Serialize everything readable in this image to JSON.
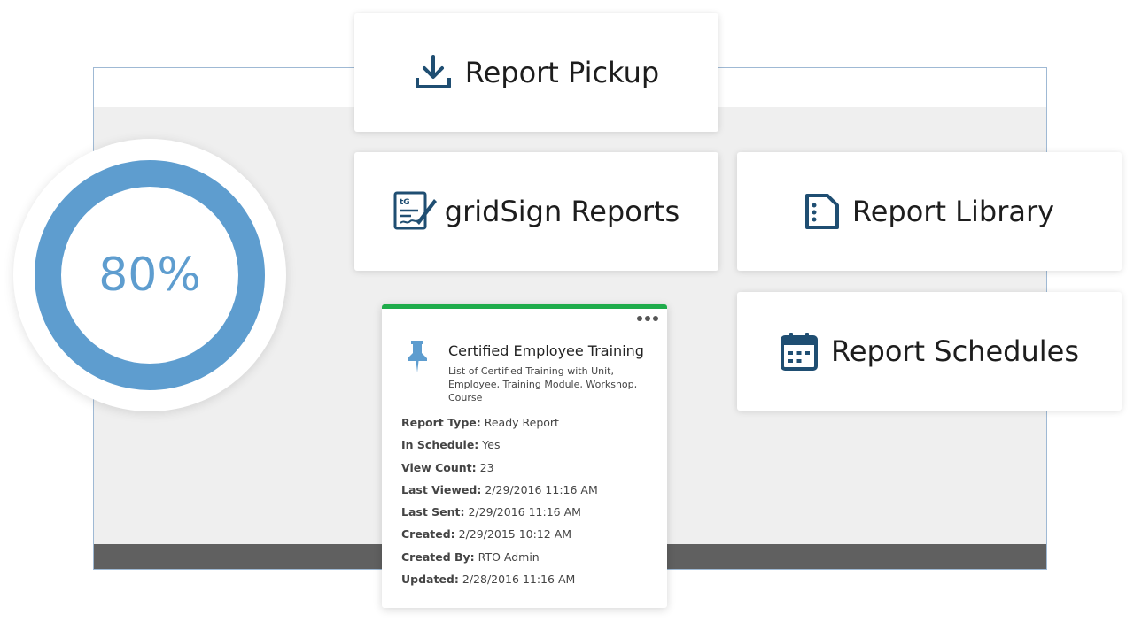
{
  "progress": {
    "label": "80%",
    "percent": 80,
    "colors": {
      "track": "#5e9dcf",
      "fill": "#1f4e72"
    }
  },
  "cards": {
    "report_pickup": {
      "label": "Report Pickup",
      "icon": "download-icon"
    },
    "gridsign_reports": {
      "label": "gridSign Reports",
      "icon": "gridsign-icon",
      "icon_text": "tG"
    },
    "report_library": {
      "label": "Report Library",
      "icon": "document-list-icon"
    },
    "report_schedules": {
      "label": "Report Schedules",
      "icon": "calendar-icon"
    }
  },
  "report": {
    "title": "Certified Employee Training",
    "description": "List of Certified Training with Unit, Employee, Training Module, Workshop, Course",
    "menu_icon": "more-options-icon",
    "pin_icon": "pin-icon",
    "accent_color": "#1fac4b",
    "details": [
      {
        "key": "Report Type:",
        "value": "Ready Report"
      },
      {
        "key": "In Schedule:",
        "value": "Yes"
      },
      {
        "key": "View Count:",
        "value": "23"
      },
      {
        "key": "Last Viewed:",
        "value": "2/29/2016 11:16 AM"
      },
      {
        "key": "Last Sent:",
        "value": "2/29/2016 11:16 AM"
      },
      {
        "key": "Created:",
        "value": "2/29/2015 10:12 AM"
      },
      {
        "key": "Created By:",
        "value": "RTO Admin"
      },
      {
        "key": "Updated:",
        "value": "2/28/2016 11:16 AM"
      }
    ]
  },
  "icon_color": "#1f4e72"
}
